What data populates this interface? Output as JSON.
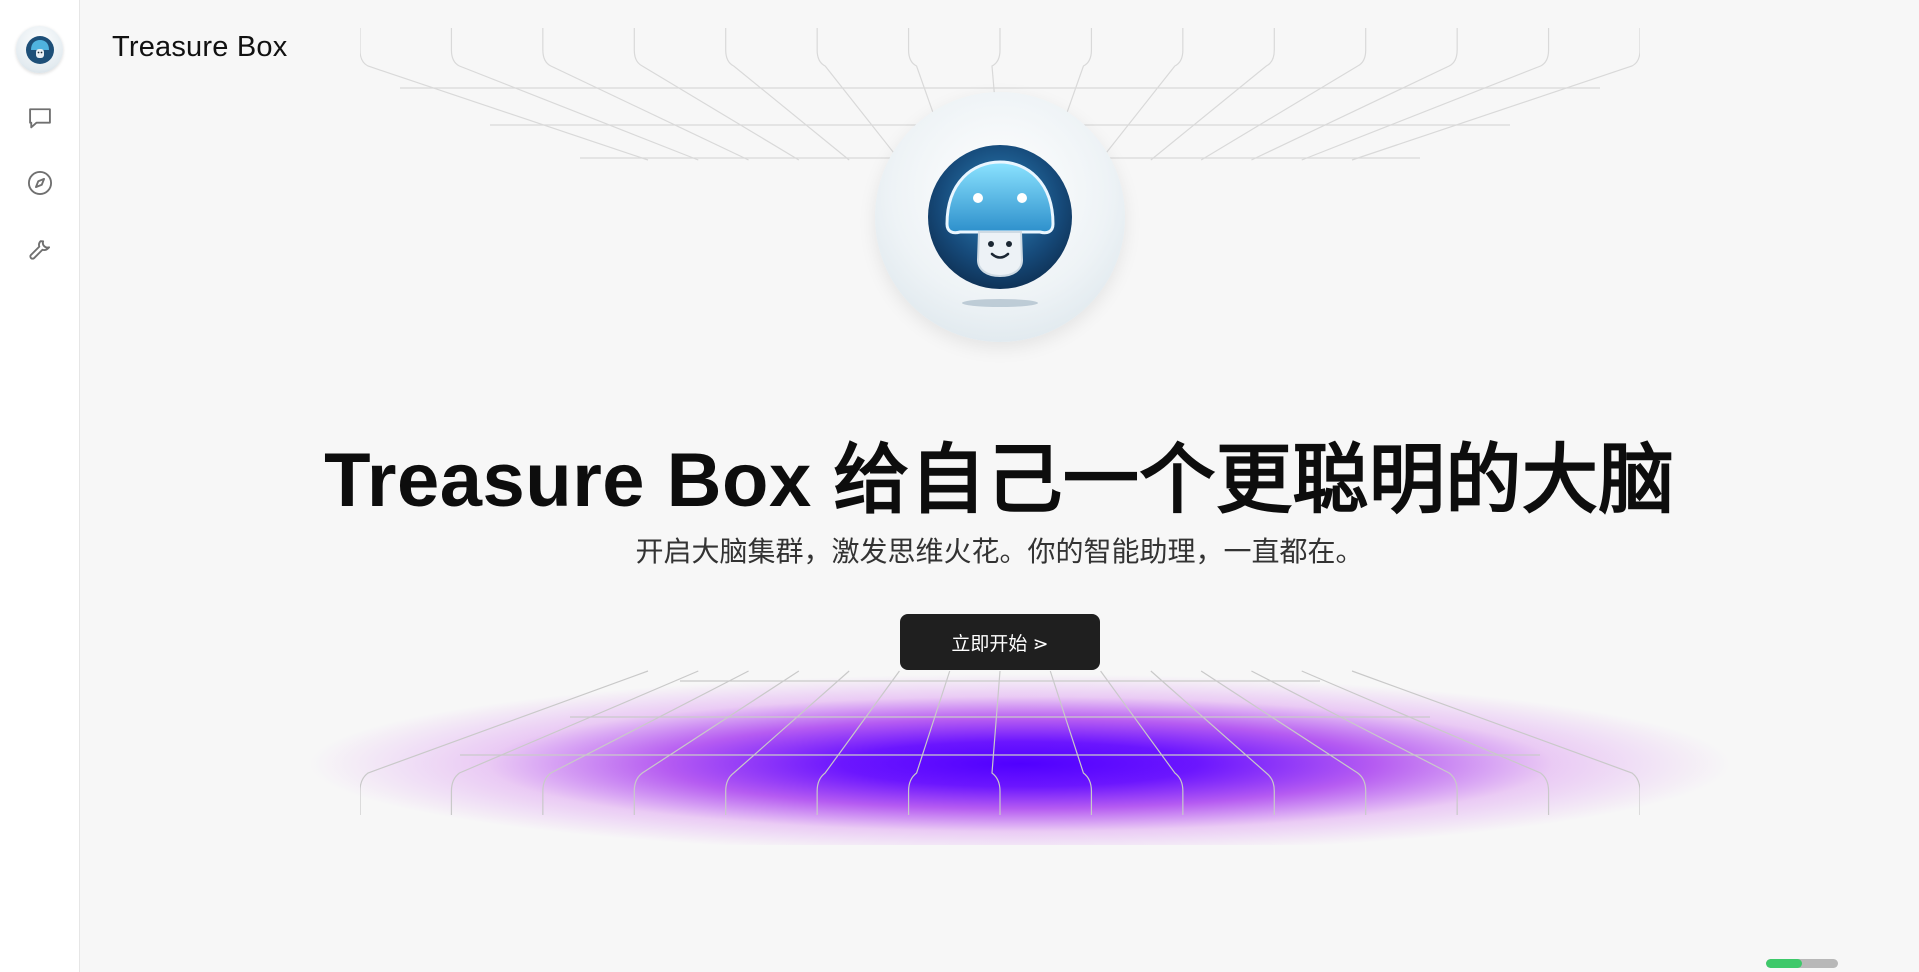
{
  "app": {
    "title": "Treasure Box"
  },
  "sidebar": {
    "items": [
      {
        "name": "chat",
        "icon": "chat-bubble-icon"
      },
      {
        "name": "discover",
        "icon": "compass-icon"
      },
      {
        "name": "tools",
        "icon": "wrench-icon"
      }
    ]
  },
  "hero": {
    "logo_icon": "mushroom-mascot-icon",
    "headline": "Treasure Box 给自己一个更聪明的大脑",
    "subtitle": "开启大脑集群，激发思维火花。你的智能助理，一直都在。",
    "cta_label": "立即开始 ⋗"
  },
  "status": {
    "progress": 0.5
  },
  "colors": {
    "background": "#f7f7f7",
    "cta_background": "#1f1f1f",
    "glow_primary": "#5000ff",
    "glow_secondary": "#c040f0",
    "progress_fill": "#3ec96a"
  }
}
